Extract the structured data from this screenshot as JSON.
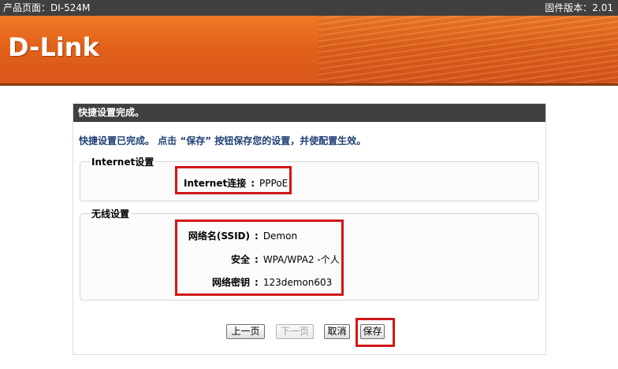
{
  "topbar": {
    "product_page": "产品页面：DI-524M",
    "firmware": "固件版本：2.01"
  },
  "banner": {
    "logo_text": "D-Link"
  },
  "panel": {
    "title": "快捷设置完成。",
    "intro": "快捷设置已完成。 点击 “保存” 按钮保存您的设置，并使配置生效。"
  },
  "internet": {
    "section_title": "Internet设置",
    "connection_label": "Internet连接",
    "connection_value": "PPPoE"
  },
  "wireless": {
    "section_title": "无线设置",
    "ssid_label": "网络名(SSID)",
    "ssid_value": "Demon",
    "security_label": "安全",
    "security_value": "WPA/WPA2 -个人",
    "key_label": "网络密钥",
    "key_value": "123demon603"
  },
  "buttons": {
    "prev": "上一页",
    "next": "下一页",
    "cancel": "取消",
    "save": "保存"
  },
  "colors": {
    "highlight": "#d01616",
    "accent_orange": "#e2621a",
    "header_dark": "#404040"
  }
}
